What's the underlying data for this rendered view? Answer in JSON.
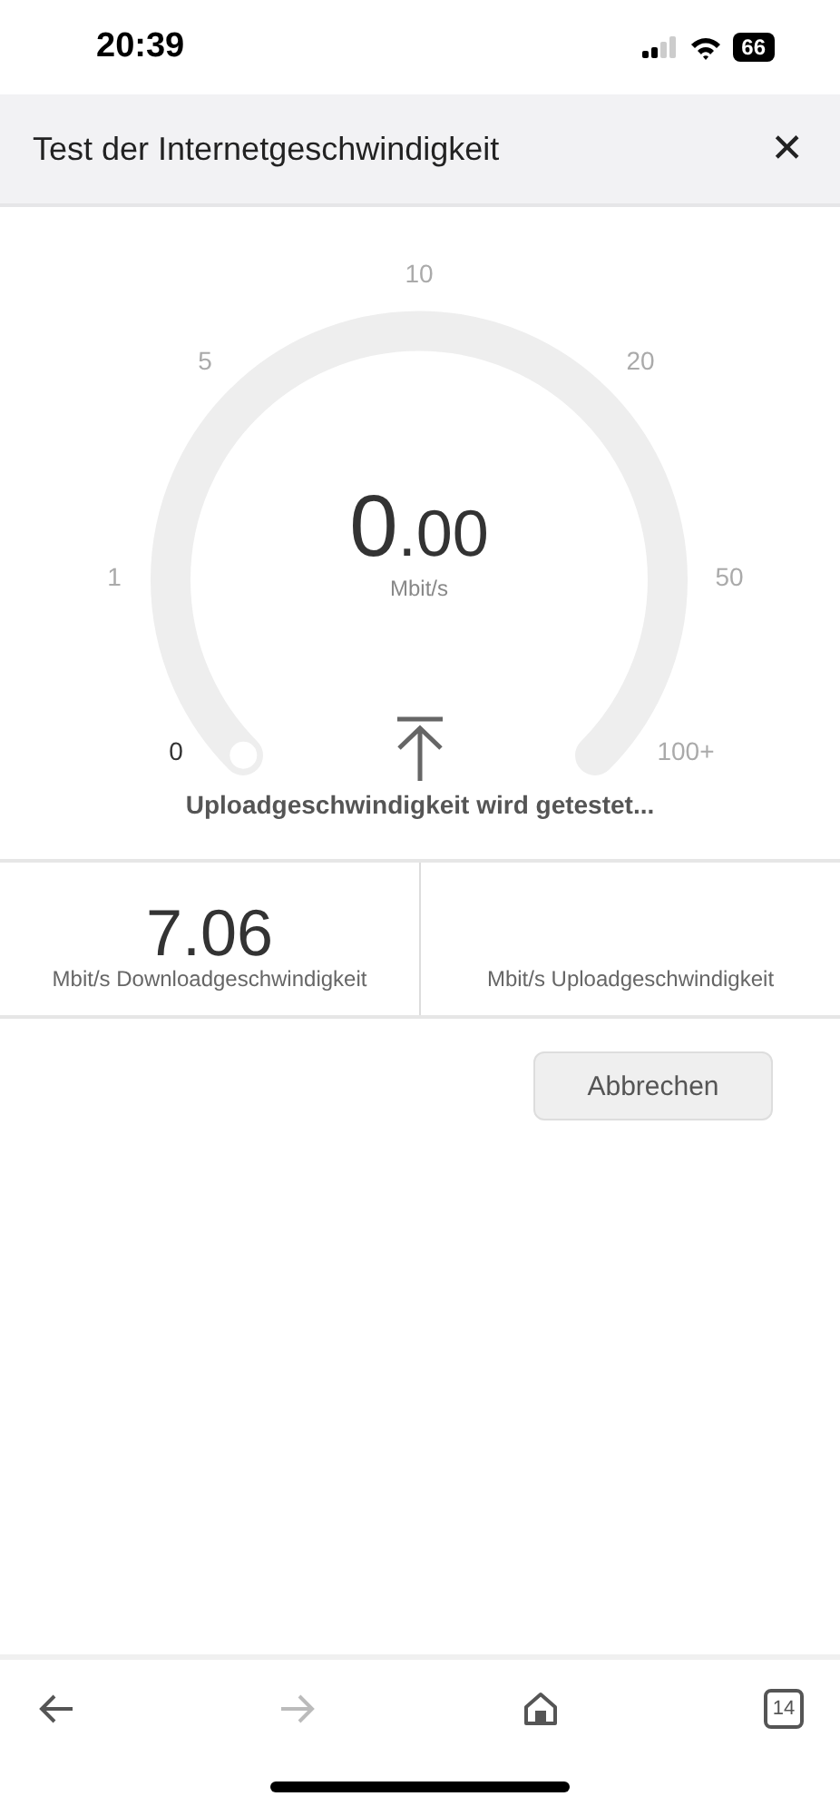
{
  "status_bar": {
    "time": "20:39",
    "battery": "66"
  },
  "header": {
    "title": "Test der Internetgeschwindigkeit",
    "close": "✕"
  },
  "gauge": {
    "ticks": [
      "0",
      "1",
      "5",
      "10",
      "20",
      "50",
      "100+"
    ],
    "value": "0.00",
    "unit": "Mbit/s",
    "status": "Uploadgeschwindigkeit wird getestet..."
  },
  "results": [
    {
      "value": "7.06",
      "label": "Mbit/s Downloadgeschwindigkeit"
    },
    {
      "label": "Mbit/s Uploadgeschwindigkeit"
    }
  ],
  "cancel_button": "Abbrechen",
  "toolbar": {
    "forward_disabled": true,
    "tab_count": "14"
  }
}
